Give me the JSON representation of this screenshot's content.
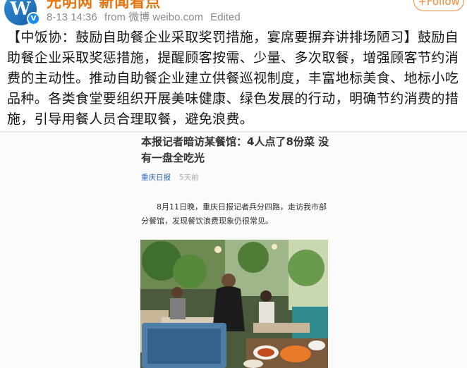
{
  "post": {
    "avatar_letter": "W",
    "verified_mark": "V",
    "username": "光明网 新闻看点",
    "date": "8-13 14:36",
    "source": "from 微博 weibo.com",
    "edited": "Edited",
    "follow_label": "+Follow",
    "text": "【中饭协：鼓励自助餐企业采取奖罚措施，宴席要摒弃讲排场陋习】鼓励自助餐企业采取奖惩措施，提醒顾客按需、少量、多次取餐，增强顾客节约消费的主动性。推动自助餐企业建立供餐巡视制度，丰富地标美食、地标小吃品种。各类食堂要组织开展美味健康、绿色发展的行动，明确节约消费的措施，引导用餐人员合理取餐，避免浪费。"
  },
  "news_card": {
    "headline": "本报记者暗访某餐馆：4人点了8份菜 没有一盘全吃光",
    "source": "重庆日报",
    "age": "5天前",
    "paragraph": "8月11日晚，重庆日报记者兵分四路，走访我市部分餐馆，发现餐饮浪费现象仍很常见。"
  },
  "colors": {
    "username": "#e6730c",
    "follow": "#f08a3a",
    "verified": "#1a8cf0",
    "news_source": "#2a66b8"
  }
}
